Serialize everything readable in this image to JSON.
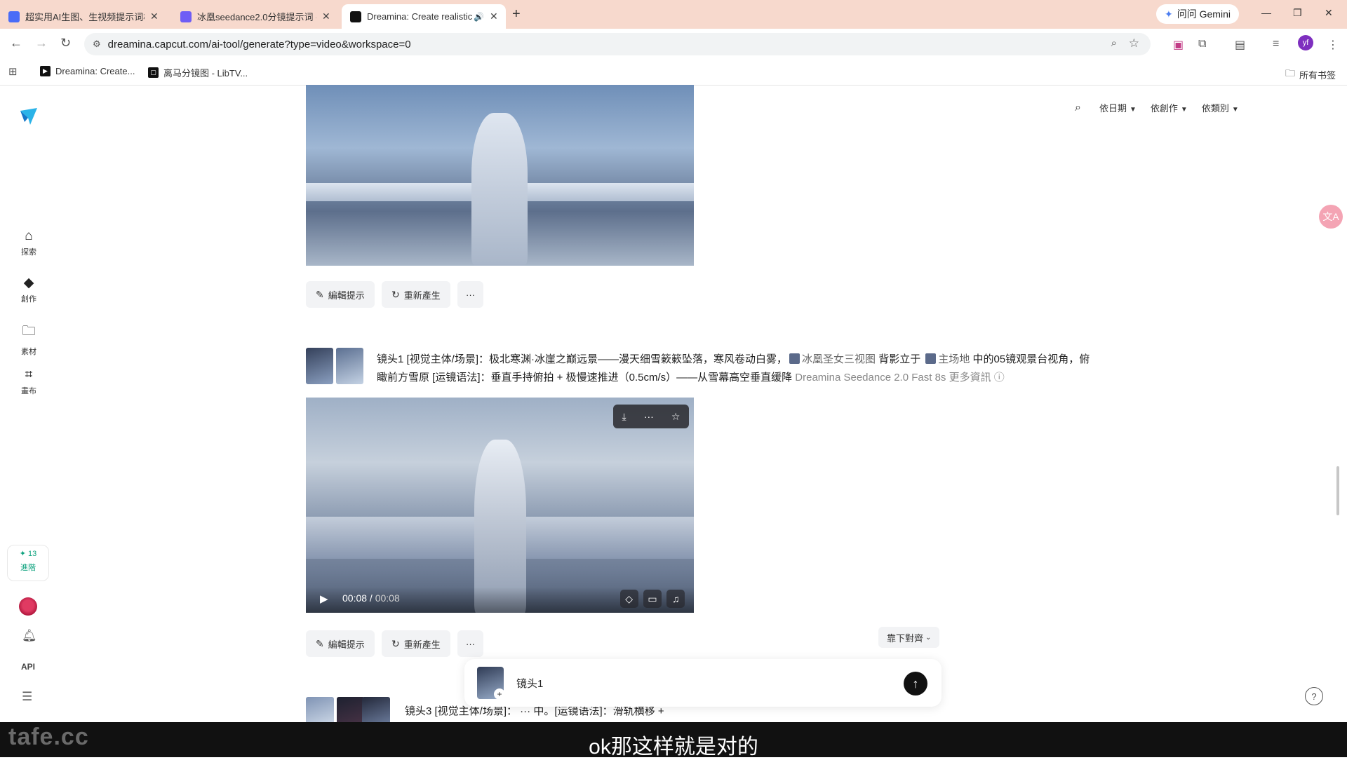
{
  "browser": {
    "tabs": [
      {
        "title": "超实用AI生图、生视频提示词模...",
        "color": "#4a6cf7"
      },
      {
        "title": "冰凰seedance2.0分镜提示词 -...",
        "color": "#6f5df5"
      },
      {
        "title": "Dreamina: Create realistic...",
        "color": "#111111"
      }
    ],
    "gemini": "问问 Gemini",
    "url": "dreamina.capcut.com/ai-tool/generate?type=video&workspace=0",
    "profile_initials": "yf",
    "bookmarks": [
      "Dreamina: Create...",
      "离马分镜图 - LibTV..."
    ],
    "all_bookmarks": "所有书签"
  },
  "sidebar": {
    "items": [
      "探索",
      "創作",
      "素材",
      "畫布"
    ],
    "credits": "13",
    "credits_label": "進階",
    "api": "API"
  },
  "filters": [
    "依日期",
    "依創作",
    "依類別"
  ],
  "actions": {
    "edit": "編輯提示",
    "regen": "重新產生",
    "more": "···"
  },
  "item2": {
    "prompt_part1": "镜头1 [视觉主体/场景]：极北寒渊·冰崖之巅远景——漫天细雪簌簌坠落，寒风卷动白雾，",
    "ref1": "冰凰圣女三视图",
    "prompt_part2": " 背影立于 ",
    "ref2": "主场地",
    "prompt_part3": " 中的05镜观景台视角，俯瞰前方雪原 [运镜语法]：垂直手持俯拍 + 极慢速推进（0.5cm/s）——从雪幕高空垂直缓降",
    "model": "Dreamina Seedance 2.0 Fast",
    "duration": "8s",
    "more_info": "更多資訊",
    "time_current": "00:08",
    "time_total": "00:08"
  },
  "align_button": "靠下對齊",
  "composer": {
    "text": "镜头1"
  },
  "item3": {
    "prompt": "镜头3 [视觉主体/场景]：        ··· 中。[运镜语法]：滑轨横移 +"
  },
  "overlay": {
    "subtitle": "ok那这样就是对的",
    "watermark": "tafe.cc"
  }
}
